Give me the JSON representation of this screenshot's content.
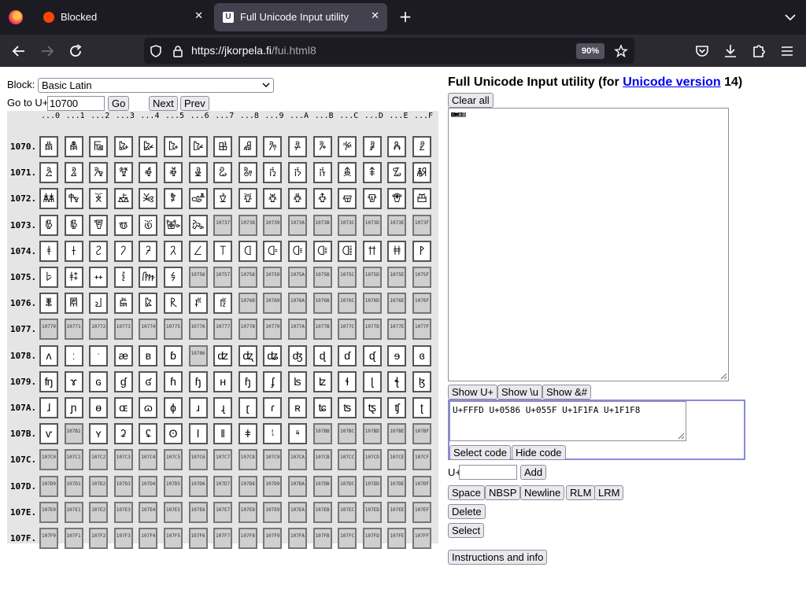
{
  "browser": {
    "tabs": [
      {
        "title": "Blocked",
        "active": false
      },
      {
        "title": "Full Unicode Input utility",
        "active": true
      }
    ],
    "url_host": "https://jkorpela.fi",
    "url_path": "/fui.html8",
    "zoom": "90%",
    "colors": {
      "tabbar": "#1c1b22",
      "navbar": "#2b2a33",
      "active_tab": "#42414d"
    }
  },
  "controls": {
    "block_label": "Block:",
    "block_value": "Basic Latin",
    "goto_label": "Go to U+",
    "goto_value": "10700",
    "go_button": "Go",
    "next_button": "Next",
    "prev_button": "Prev"
  },
  "grid": {
    "column_headers": [
      "...0",
      "...1",
      "...2",
      "...3",
      "...4",
      "...5",
      "...6",
      "...7",
      "...8",
      "...9",
      "...A",
      "...B",
      "...C",
      "...D",
      "...E",
      "...F"
    ],
    "rows": [
      {
        "label": "1070.",
        "cells": [
          "𐜀",
          "𐜁",
          "𐜂",
          "𐜃",
          "𐜄",
          "𐜅",
          "𐜆",
          "𐜇",
          "𐜈",
          "𐜉",
          "𐜊",
          "𐜋",
          "𐜌",
          "𐜍",
          "𐜎",
          "𐜏"
        ]
      },
      {
        "label": "1071.",
        "cells": [
          "𐜐",
          "𐜑",
          "𐜒",
          "𐜓",
          "𐜔",
          "𐜕",
          "𐜖",
          "𐜗",
          "𐜘",
          "𐜙",
          "𐜚",
          "𐜛",
          "𐜜",
          "𐜝",
          "𐜞",
          "𐜟"
        ]
      },
      {
        "label": "1072.",
        "cells": [
          "𐜠",
          "𐜡",
          "𐜢",
          "𐜣",
          "𐜤",
          "𐜥",
          "𐜦",
          "𐜧",
          "𐜨",
          "𐜩",
          "𐜪",
          "𐜫",
          "𐜬",
          "𐜭",
          "𐜮",
          "𐜯"
        ]
      },
      {
        "label": "1073.",
        "cells": [
          "𐜰",
          "𐜱",
          "𐜲",
          "𐜳",
          "𐜴",
          "𐜵",
          "𐜶",
          "10737",
          "10738",
          "10739",
          "1073A",
          "1073B",
          "1073C",
          "1073D",
          "1073E",
          "1073F"
        ]
      },
      {
        "label": "1074.",
        "cells": [
          "𐝀",
          "𐝁",
          "𐝂",
          "𐝃",
          "𐝄",
          "𐝅",
          "𐝆",
          "𐝇",
          "𐝈",
          "𐝉",
          "𐝊",
          "𐝋",
          "𐝌",
          "𐝍",
          "𐝎",
          "𐝏"
        ]
      },
      {
        "label": "1075.",
        "cells": [
          "𐝐",
          "𐝑",
          "𐝒",
          "𐝓",
          "𐝔",
          "𐝕",
          "10756",
          "10757",
          "10758",
          "10759",
          "1075A",
          "1075B",
          "1075C",
          "1075D",
          "1075E",
          "1075F"
        ]
      },
      {
        "label": "1076.",
        "cells": [
          "𐝠",
          "𐝡",
          "𐝢",
          "𐝣",
          "𐝤",
          "𐝥",
          "𐝦",
          "𐝧",
          "10768",
          "10769",
          "1076A",
          "1076B",
          "1076C",
          "1076D",
          "1076E",
          "1076F"
        ]
      },
      {
        "label": "1077.",
        "cells": [
          "10770",
          "10771",
          "10772",
          "10773",
          "10774",
          "10775",
          "10776",
          "10777",
          "10778",
          "10779",
          "1077A",
          "1077B",
          "1077C",
          "1077D",
          "1077E",
          "1077F"
        ]
      },
      {
        "label": "1078.",
        "cells": [
          "ʌ",
          "ː",
          "ˑ",
          "æ",
          "ʙ",
          "ɓ",
          "10786",
          "ʣ",
          "ꭦ",
          "ʥ",
          "ʤ",
          "ɖ",
          "ɗ",
          "ᶑ",
          "ɘ",
          "ɞ"
        ]
      },
      {
        "label": "1079.",
        "cells": [
          "ʩ",
          "ɤ",
          "ɢ",
          "ɠ",
          "ʛ",
          "ɦ",
          "ɧ",
          "ʜ",
          "ɧ",
          "ʄ",
          "ʪ",
          "ʫ",
          "ɬ",
          "ɭ",
          "ꞎ",
          "ɮ"
        ]
      },
      {
        "label": "107A.",
        "cells": [
          "ɺ",
          "ɲ",
          "ɵ",
          "ɶ",
          "ɷ",
          "ɸ",
          "ɹ",
          "ɻ",
          "ɽ",
          "ɾ",
          "ʀ",
          "ʨ",
          "ʦ",
          "ꭧ",
          "ʧ",
          "ʈ"
        ]
      },
      {
        "label": "107B.",
        "cells": [
          "ⱱ",
          "107B1",
          "ʏ",
          "ʡ",
          "ʢ",
          "ʘ",
          "ǀ",
          "ǁ",
          "ǂ",
          "𐞹",
          "𐞺",
          "107BB",
          "107BC",
          "107BD",
          "107BE",
          "107BF"
        ]
      },
      {
        "label": "107C.",
        "cells": [
          "107C0",
          "107C1",
          "107C2",
          "107C3",
          "107C4",
          "107C5",
          "107C6",
          "107C7",
          "107C8",
          "107C9",
          "107CA",
          "107CB",
          "107CC",
          "107CD",
          "107CE",
          "107CF"
        ]
      },
      {
        "label": "107D.",
        "cells": [
          "107D0",
          "107D1",
          "107D2",
          "107D3",
          "107D4",
          "107D5",
          "107D6",
          "107D7",
          "107D8",
          "107D9",
          "107DA",
          "107DB",
          "107DC",
          "107DD",
          "107DE",
          "107DF"
        ]
      },
      {
        "label": "107E.",
        "cells": [
          "107E0",
          "107E1",
          "107E2",
          "107E3",
          "107E4",
          "107E5",
          "107E6",
          "107E7",
          "107E8",
          "107E9",
          "107EA",
          "107EB",
          "107EC",
          "107ED",
          "107EE",
          "107EF"
        ]
      },
      {
        "label": "107F.",
        "cells": [
          "107F0",
          "107F1",
          "107F2",
          "107F3",
          "107F4",
          "107F5",
          "107F6",
          "107F7",
          "107F8",
          "107F9",
          "107FA",
          "107FB",
          "107FC",
          "107FD",
          "107FE",
          "107FF"
        ]
      }
    ]
  },
  "panel": {
    "title_prefix": "Full Unicode Input utility (for ",
    "title_link": "Unicode version",
    "title_suffix": " 14)",
    "clear_all": "Clear all",
    "big_text": "▩▣▥▤",
    "show_u_plus": "Show U+",
    "show_backslash_u": "Show \\u",
    "show_amp": "Show &#",
    "code_text": "U+FFFD U+0586 U+055F U+1F1FA U+1F1F8",
    "select_code": "Select code",
    "hide_code": "Hide code",
    "u_plus_label": "U+",
    "u_plus_value": "",
    "add": "Add",
    "space": "Space",
    "nbsp": "NBSP",
    "newline": "Newline",
    "rlm": "RLM",
    "lrm": "LRM",
    "delete": "Delete",
    "select": "Select",
    "instructions": "Instructions and info"
  }
}
